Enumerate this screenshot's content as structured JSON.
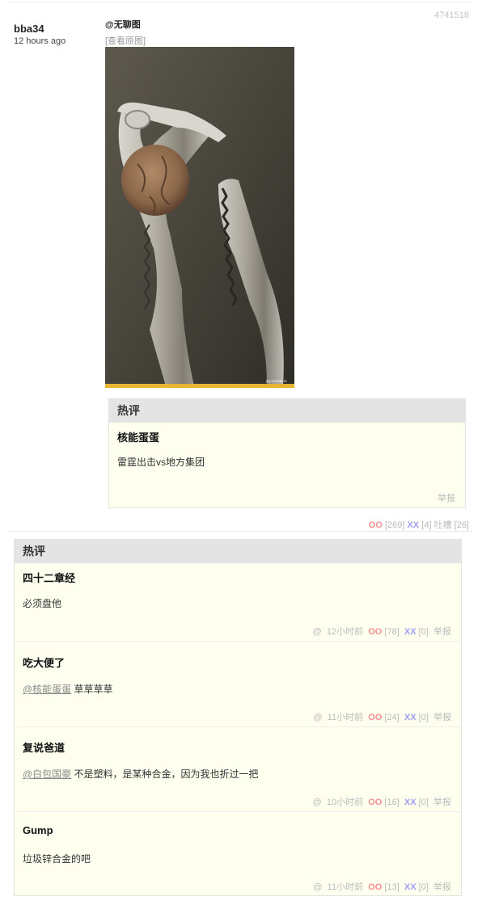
{
  "post": {
    "id": "4741518",
    "author": "bba34",
    "time": "12 hours ago",
    "at_tag": "@无聊图",
    "view_original": "[查看原图]",
    "image_watermark": "joy.reactor.cc"
  },
  "inline_hot": {
    "header": "热评",
    "author": "核能蛋蛋",
    "text": "雷霆出击vs地方集团",
    "report": "举报"
  },
  "post_votes": {
    "oo_label": "OO",
    "oo_count": "[269]",
    "xx_label": "XX",
    "xx_count": "[4]",
    "tucao_label": "吐槽",
    "tucao_count": "[26]"
  },
  "hot_comments": {
    "header": "热评",
    "items": [
      {
        "author": "四十二章经",
        "mention": "",
        "text": "必须盘他",
        "at": "@",
        "time": "12小时前",
        "oo": "OO",
        "oo_count": "[78]",
        "xx": "XX",
        "xx_count": "[0]",
        "report": "举报"
      },
      {
        "author": "吃大便了",
        "mention": "@核能蛋蛋",
        "text": "草草草草",
        "at": "@",
        "time": "11小时前",
        "oo": "OO",
        "oo_count": "[24]",
        "xx": "XX",
        "xx_count": "[0]",
        "report": "举报"
      },
      {
        "author": "复说爸道",
        "mention": "@白包国豪",
        "text": "不是塑料，是某种合金，因为我也折过一把",
        "at": "@",
        "time": "10小时前",
        "oo": "OO",
        "oo_count": "[16]",
        "xx": "XX",
        "xx_count": "[0]",
        "report": "举报"
      },
      {
        "author": "Gump",
        "mention": "",
        "text": "垃圾锌合金的吧",
        "at": "@",
        "time": "11小时前",
        "oo": "OO",
        "oo_count": "[13]",
        "xx": "XX",
        "xx_count": "[0]",
        "report": "举报"
      }
    ]
  },
  "colors": {
    "oo": "#f29090",
    "xx": "#9ea0ee",
    "box_bg": "#fffff0",
    "header_bg": "#e4e4e4"
  }
}
